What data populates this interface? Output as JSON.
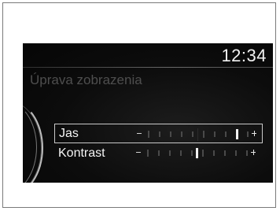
{
  "header": {
    "clock": "12:34"
  },
  "screen": {
    "title": "Úprava zobrazenia"
  },
  "settings": [
    {
      "label": "Jas",
      "selected": true,
      "level_fraction": 0.9
    },
    {
      "label": "Kontrast",
      "selected": false,
      "level_fraction": 0.5
    }
  ],
  "colors": {
    "screen_background": "#0a0a0a",
    "text": "#f2f2f2",
    "title_text": "#4e4e4e",
    "selection_border": "#c9c9c9"
  }
}
